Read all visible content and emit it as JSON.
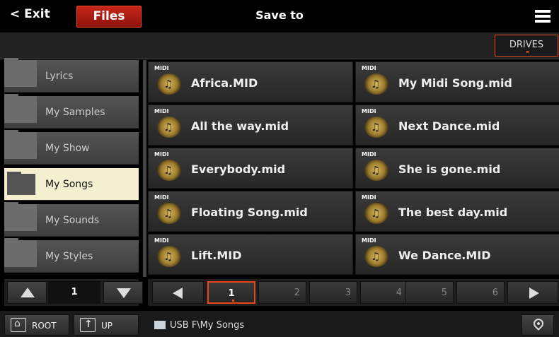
{
  "header": {
    "exit_label": "< Exit",
    "files_tab": "Files",
    "title": "Save to",
    "menu_icon": "hamburger-menu-icon"
  },
  "drives_button": "DRIVES",
  "folders": [
    {
      "label": "Lyrics",
      "selected": false
    },
    {
      "label": "My Samples",
      "selected": false
    },
    {
      "label": "My Show",
      "selected": false
    },
    {
      "label": "My Songs",
      "selected": true
    },
    {
      "label": "My Sounds",
      "selected": false
    },
    {
      "label": "My Styles",
      "selected": false
    }
  ],
  "folder_page": "1",
  "files": [
    {
      "name": "Africa.MID",
      "icon": "midi-file-icon"
    },
    {
      "name": "My Midi Song.mid",
      "icon": "midi-file-icon"
    },
    {
      "name": "All the way.mid",
      "icon": "midi-file-icon"
    },
    {
      "name": "Next Dance.mid",
      "icon": "midi-file-icon"
    },
    {
      "name": "Everybody.mid",
      "icon": "midi-file-icon"
    },
    {
      "name": "She is gone.mid",
      "icon": "midi-file-icon"
    },
    {
      "name": "Floating Song.mid",
      "icon": "midi-file-icon"
    },
    {
      "name": "The best day.mid",
      "icon": "midi-file-icon"
    },
    {
      "name": "Lift.MID",
      "icon": "midi-file-icon"
    },
    {
      "name": "We Dance.MID",
      "icon": "midi-file-icon"
    }
  ],
  "midi_tag": "MIDI",
  "pages": [
    "1",
    "2",
    "3",
    "4",
    "5",
    "6"
  ],
  "active_page": "1",
  "footer": {
    "root_label": "ROOT",
    "up_label": "UP",
    "path": "USB F\\My Songs"
  },
  "colors": {
    "accent": "#e8481a",
    "files_tab": "#b01e14",
    "selected_folder": "#f3efcf"
  }
}
